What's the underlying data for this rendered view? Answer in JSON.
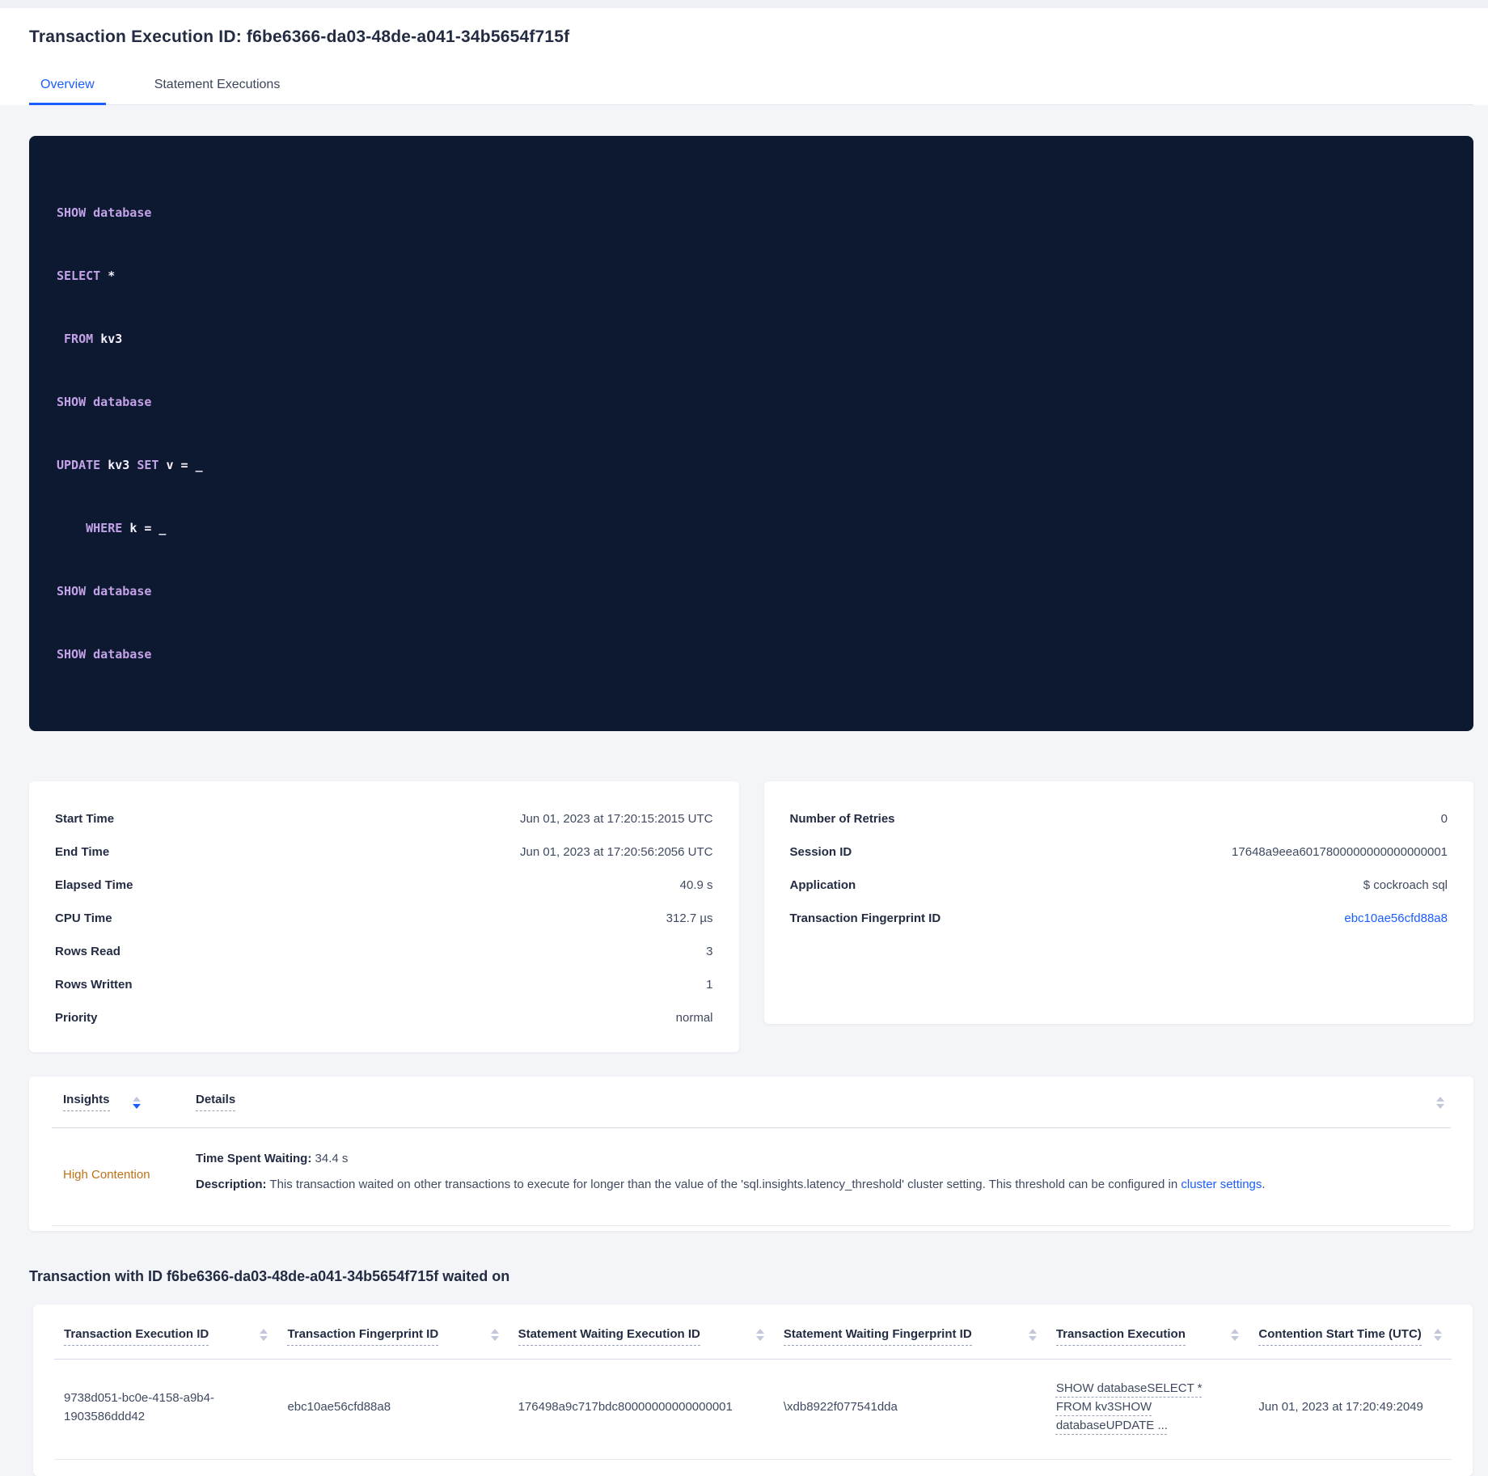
{
  "header": {
    "title": "Transaction Execution ID: f6be6366-da03-48de-a041-34b5654f715f",
    "tabs": [
      {
        "label": "Overview"
      },
      {
        "label": "Statement Executions"
      }
    ]
  },
  "sql": {
    "lines": [
      [
        {
          "t": "SHOW database",
          "c": "kw"
        }
      ],
      [
        {
          "t": "SELECT ",
          "c": "kw"
        },
        {
          "t": "*",
          "c": "id"
        }
      ],
      [
        {
          "t": " FROM ",
          "c": "kw"
        },
        {
          "t": "kv3",
          "c": "id"
        }
      ],
      [
        {
          "t": "SHOW database",
          "c": "kw"
        }
      ],
      [
        {
          "t": "UPDATE ",
          "c": "kw"
        },
        {
          "t": "kv3 ",
          "c": "id"
        },
        {
          "t": "SET ",
          "c": "kw"
        },
        {
          "t": "v = _",
          "c": "id"
        }
      ],
      [
        {
          "t": "    WHERE ",
          "c": "kw"
        },
        {
          "t": "k = _",
          "c": "id"
        }
      ],
      [
        {
          "t": "SHOW database",
          "c": "kw"
        }
      ],
      [
        {
          "t": "SHOW database",
          "c": "kw"
        }
      ]
    ]
  },
  "summary_left": {
    "rows": [
      {
        "label": "Start Time",
        "value": "Jun 01, 2023 at 17:20:15:2015 UTC"
      },
      {
        "label": "End Time",
        "value": "Jun 01, 2023 at 17:20:56:2056 UTC"
      },
      {
        "label": "Elapsed Time",
        "value": "40.9 s"
      },
      {
        "label": "CPU Time",
        "value": "312.7 µs"
      },
      {
        "label": "Rows Read",
        "value": "3"
      },
      {
        "label": "Rows Written",
        "value": "1"
      },
      {
        "label": "Priority",
        "value": "normal"
      }
    ]
  },
  "summary_right": {
    "rows": [
      {
        "label": "Number of Retries",
        "value": "0"
      },
      {
        "label": "Session ID",
        "value": "17648a9eea6017800000000000000001"
      },
      {
        "label": "Application",
        "value": "$ cockroach sql"
      },
      {
        "label": "Transaction Fingerprint ID",
        "value": "ebc10ae56cfd88a8"
      }
    ]
  },
  "insights_table": {
    "col_insights": "Insights",
    "col_details": "Details",
    "row": {
      "insight": "High Contention",
      "waiting_label": "Time Spent Waiting:",
      "waiting_value": " 34.4 s",
      "description_label": "Description:",
      "description_text": " This transaction waited on other transactions to execute for longer than the value of the 'sql.insights.latency_threshold' cluster setting. This threshold can be configured in ",
      "link_text": "cluster settings",
      "suffix": "."
    }
  },
  "waited_on": {
    "heading": "Transaction with ID f6be6366-da03-48de-a041-34b5654f715f waited on",
    "columns": [
      "Transaction Execution ID",
      "Transaction Fingerprint ID",
      "Statement Waiting Execution ID",
      "Statement Waiting Fingerprint ID",
      "Transaction Execution",
      "Contention Start Time (UTC)"
    ],
    "row": {
      "txn_execution_id": "9738d051-bc0e-4158-a9b4-1903586ddd42",
      "txn_fingerprint_id": "ebc10ae56cfd88a8",
      "stmt_waiting_execution_id": "176498a9c717bdc80000000000000001",
      "stmt_waiting_fingerprint_id": "\\xdb8922f077541dda",
      "txn_execution": "SHOW databaseSELECT * FROM kv3SHOW databaseUPDATE ...",
      "contention_start_time": "Jun 01, 2023 at 17:20:49:2049"
    }
  },
  "colors": {
    "accent_blue": "#1b5dff",
    "warning_orange": "#bf7114",
    "code_background": "#0d1930",
    "code_keyword": "#c3a2e8",
    "code_identifier": "#f5f1fd",
    "page_background": "#f4f5f9"
  }
}
